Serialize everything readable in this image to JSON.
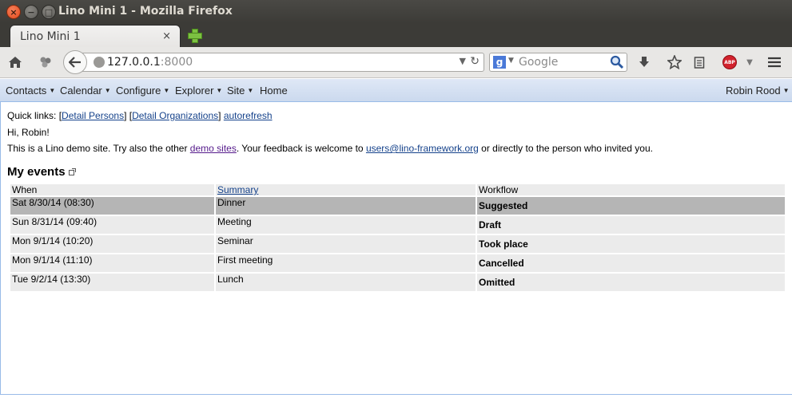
{
  "window": {
    "title": "Lino Mini 1 - Mozilla Firefox"
  },
  "tab": {
    "label": "Lino Mini 1",
    "close": "×"
  },
  "navbar": {
    "url_host": "127.0.0.1",
    "url_port": ":8000",
    "search_placeholder": "Google",
    "search_engine": "g",
    "adblock_label": "ABP"
  },
  "app_menu": {
    "contacts": "Contacts",
    "calendar": "Calendar",
    "configure": "Configure",
    "explorer": "Explorer",
    "site": "Site",
    "home": "Home",
    "user": "Robin Rood"
  },
  "content": {
    "quick_links_label": "Quick links:",
    "links": {
      "detail_persons": "Detail Persons",
      "detail_organizations": "Detail Organizations",
      "autorefresh": "autorefresh"
    },
    "greeting": "Hi, Robin!",
    "intro_prefix": "This is a Lino demo site. Try also the other",
    "intro_link": "demo sites",
    "intro_middle": ". Your feedback is welcome to",
    "intro_email": "users@lino-framework.org",
    "intro_suffix": "or directly to the person who invited you.",
    "events_title": "My events"
  },
  "events_table": {
    "columns": {
      "when": "When",
      "summary": "Summary",
      "workflow": "Workflow"
    },
    "rows": [
      {
        "when": "Sat 8/30/14 (08:30)",
        "summary": "Dinner",
        "workflow": "Suggested"
      },
      {
        "when": "Sun 8/31/14 (09:40)",
        "summary": "Meeting",
        "workflow": "Draft"
      },
      {
        "when": "Mon 9/1/14 (10:20)",
        "summary": "Seminar",
        "workflow": "Took place"
      },
      {
        "when": "Mon 9/1/14 (11:10)",
        "summary": "First meeting",
        "workflow": "Cancelled"
      },
      {
        "when": "Tue 9/2/14 (13:30)",
        "summary": "Lunch",
        "workflow": "Omitted"
      }
    ]
  }
}
